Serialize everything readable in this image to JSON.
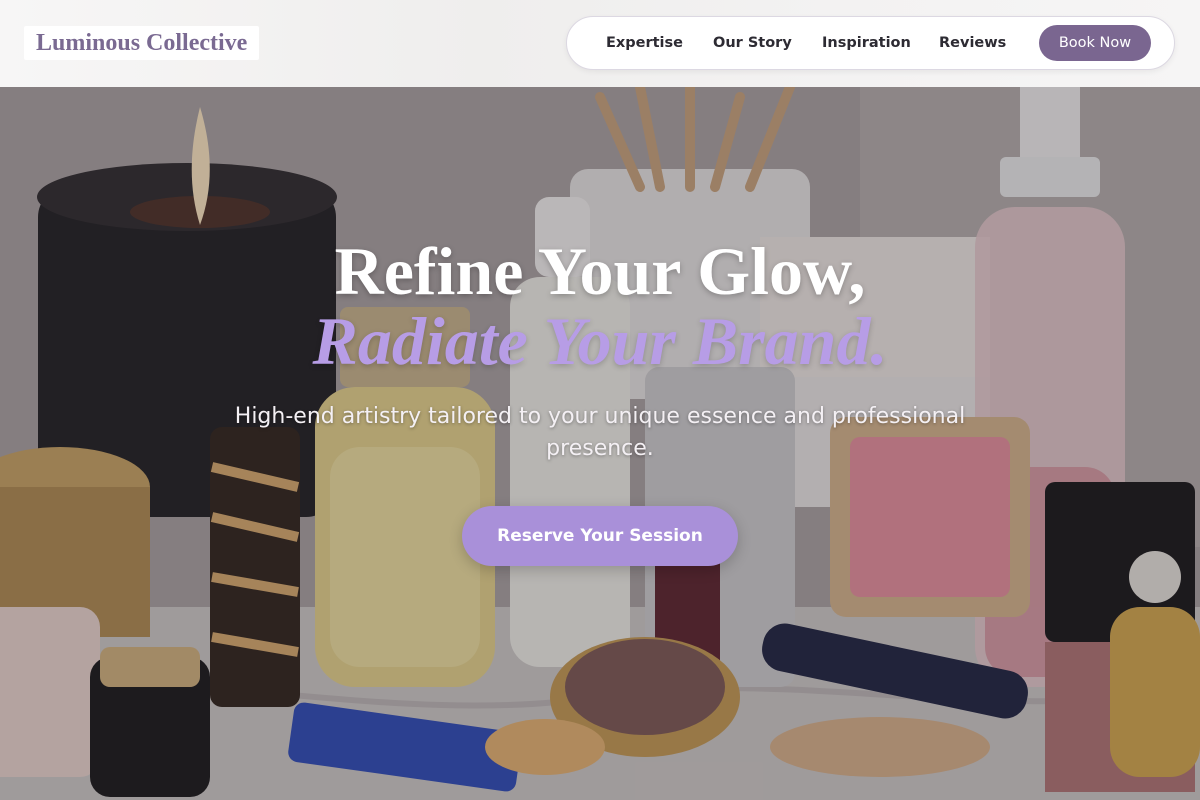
{
  "header": {
    "logo_text": "Luminous Collective",
    "nav": [
      {
        "label": "Expertise"
      },
      {
        "label": "Our Story"
      },
      {
        "label": "Inspiration"
      },
      {
        "label": "Reviews"
      }
    ],
    "book_label": "Book Now"
  },
  "hero": {
    "title": "Refine Your Glow,",
    "accent": "Radiate Your Brand.",
    "subtitle": "High-end artistry tailored to your unique essence and professional presence.",
    "cta_label": "Reserve Your Session",
    "background": "hero-cosmetics-vanity-photo"
  },
  "colors": {
    "brand_purple": "#7a6690",
    "accent_lavender": "#b79de6",
    "cta_lavender": "#a990d9",
    "logo_purple": "#7a6a92"
  }
}
